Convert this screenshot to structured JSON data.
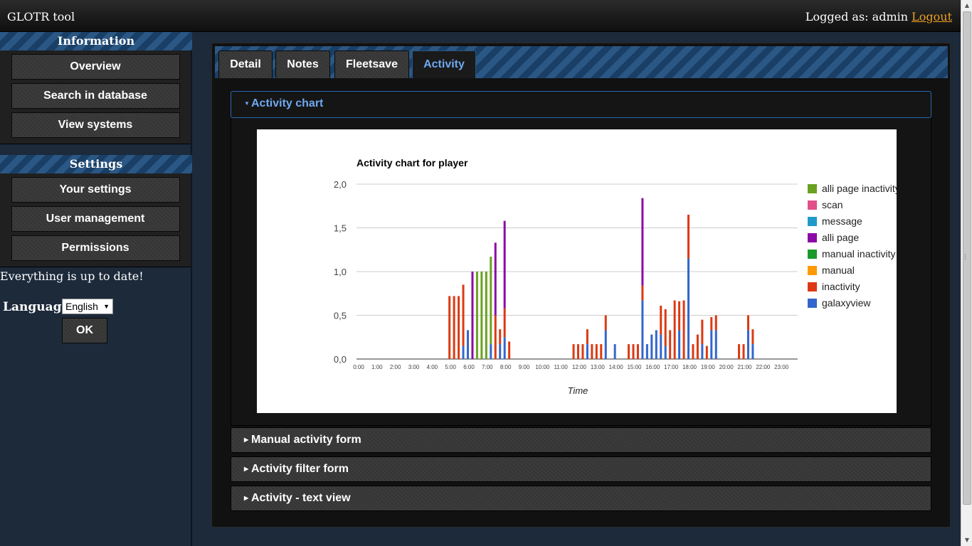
{
  "app_title": "GLOTR tool",
  "header": {
    "logged_as": "Logged as: admin",
    "logout": "Logout"
  },
  "sidebar": {
    "information_title": "Information",
    "information_items": [
      {
        "label": "Overview"
      },
      {
        "label": "Search in database"
      },
      {
        "label": "View systems"
      }
    ],
    "settings_title": "Settings",
    "settings_items": [
      {
        "label": "Your settings"
      },
      {
        "label": "User management"
      },
      {
        "label": "Permissions"
      }
    ],
    "status": "Everything is up to date!",
    "language_label": "Language",
    "language_value": "English",
    "ok_label": "OK"
  },
  "tabs": [
    {
      "label": "Detail"
    },
    {
      "label": "Notes"
    },
    {
      "label": "Fleetsave"
    },
    {
      "label": "Activity",
      "active": true
    }
  ],
  "accordion": [
    {
      "label": "Activity chart",
      "expanded": true
    },
    {
      "label": "Manual activity form"
    },
    {
      "label": "Activity filter form"
    },
    {
      "label": "Activity - text view"
    }
  ],
  "chart_data": {
    "type": "bar",
    "stacked": true,
    "title": "Activity chart for player",
    "xlabel": "Time",
    "ylabel": "",
    "ylim": [
      0,
      2
    ],
    "yticks": [
      "0,0",
      "0,5",
      "1,0",
      "1,5",
      "2,0"
    ],
    "xticks": [
      "0:00",
      "1:00",
      "2:00",
      "3:00",
      "4:00",
      "5:00",
      "6:00",
      "7:00",
      "8:00",
      "9:00",
      "10:00",
      "11:00",
      "12:00",
      "13:00",
      "14:00",
      "15:00",
      "16:00",
      "17:00",
      "18:00",
      "19:00",
      "20:00",
      "21:00",
      "22:00",
      "23:00"
    ],
    "legend_position": "right",
    "series": [
      {
        "name": "alli page inactivity",
        "color": "#6aa121"
      },
      {
        "name": "scan",
        "color": "#e0508a"
      },
      {
        "name": "message",
        "color": "#1f9ac8"
      },
      {
        "name": "alli page",
        "color": "#8b0aa5"
      },
      {
        "name": "manual inactivity",
        "color": "#1a9a2a"
      },
      {
        "name": "manual",
        "color": "#ff9900"
      },
      {
        "name": "inactivity",
        "color": "#dc3912"
      },
      {
        "name": "galaxyview",
        "color": "#3366cc"
      }
    ],
    "bars": [
      {
        "time": "5:00",
        "inactivity": 0.72
      },
      {
        "time": "5:15",
        "inactivity": 0.72
      },
      {
        "time": "5:30",
        "inactivity": 0.72
      },
      {
        "time": "5:45",
        "galaxyview": 0.15,
        "inactivity": 0.7
      },
      {
        "time": "6:00",
        "galaxyview": 0.33
      },
      {
        "time": "6:15",
        "alli page": 1.0
      },
      {
        "time": "6:30",
        "alli page inactivity": 1.0
      },
      {
        "time": "6:45",
        "alli page inactivity": 1.0
      },
      {
        "time": "7:00",
        "alli page inactivity": 1.0
      },
      {
        "time": "7:15",
        "galaxyview": 0.17,
        "alli page inactivity": 1.0
      },
      {
        "time": "7:30",
        "inactivity": 0.5,
        "alli page": 0.83
      },
      {
        "time": "7:45",
        "galaxyview": 0.17,
        "inactivity": 0.17
      },
      {
        "time": "8:00",
        "galaxyview": 0.25,
        "inactivity": 0.33,
        "alli page": 1.0
      },
      {
        "time": "8:15",
        "inactivity": 0.2
      },
      {
        "time": "11:45",
        "inactivity": 0.17
      },
      {
        "time": "12:00",
        "inactivity": 0.17
      },
      {
        "time": "12:15",
        "inactivity": 0.17
      },
      {
        "time": "12:30",
        "galaxyview": 0.17,
        "inactivity": 0.17
      },
      {
        "time": "12:45",
        "inactivity": 0.17
      },
      {
        "time": "13:00",
        "inactivity": 0.17
      },
      {
        "time": "13:15",
        "inactivity": 0.17
      },
      {
        "time": "13:30",
        "galaxyview": 0.33,
        "inactivity": 0.17
      },
      {
        "time": "14:00",
        "galaxyview": 0.17
      },
      {
        "time": "14:45",
        "inactivity": 0.17
      },
      {
        "time": "15:00",
        "inactivity": 0.17
      },
      {
        "time": "15:15",
        "inactivity": 0.17
      },
      {
        "time": "15:30",
        "galaxyview": 0.67,
        "inactivity": 0.17,
        "alli page": 1.0
      },
      {
        "time": "15:45",
        "galaxyview": 0.17
      },
      {
        "time": "16:00",
        "galaxyview": 0.28
      },
      {
        "time": "16:15",
        "galaxyview": 0.33
      },
      {
        "time": "16:30",
        "galaxyview": 0.28,
        "inactivity": 0.33
      },
      {
        "time": "16:45",
        "galaxyview": 0.15,
        "inactivity": 0.42
      },
      {
        "time": "17:00",
        "inactivity": 0.33
      },
      {
        "time": "17:15",
        "inactivity": 0.67
      },
      {
        "time": "17:30",
        "galaxyview": 0.33,
        "inactivity": 0.33
      },
      {
        "time": "17:45",
        "inactivity": 0.67
      },
      {
        "time": "18:00",
        "galaxyview": 1.15,
        "inactivity": 0.5
      },
      {
        "time": "18:15",
        "inactivity": 0.17
      },
      {
        "time": "18:30",
        "inactivity": 0.28
      },
      {
        "time": "18:45",
        "galaxyview": 0.17,
        "inactivity": 0.28
      },
      {
        "time": "19:00",
        "inactivity": 0.15
      },
      {
        "time": "19:15",
        "galaxyview": 0.33,
        "inactivity": 0.15
      },
      {
        "time": "19:30",
        "galaxyview": 0.33,
        "inactivity": 0.17
      },
      {
        "time": "20:45",
        "inactivity": 0.17
      },
      {
        "time": "21:00",
        "inactivity": 0.17
      },
      {
        "time": "21:15",
        "galaxyview": 0.33,
        "inactivity": 0.17
      },
      {
        "time": "21:30",
        "galaxyview": 0.17,
        "inactivity": 0.17
      }
    ]
  }
}
